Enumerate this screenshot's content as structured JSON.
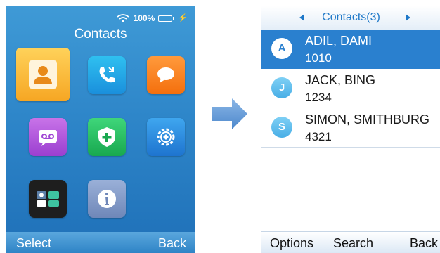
{
  "status_bar": {
    "battery_text": "100%",
    "icons": [
      "wifi-icon",
      "battery-icon",
      "charging-icon"
    ]
  },
  "menu": {
    "title": "Contacts",
    "apps": [
      {
        "name": "contacts-app",
        "icon": "contact-person-icon",
        "selected": true
      },
      {
        "name": "call-history-app",
        "icon": "call-log-icon"
      },
      {
        "name": "messages-app",
        "icon": "chat-bubble-icon"
      },
      {
        "name": "voicemail-app",
        "icon": "voicemail-icon"
      },
      {
        "name": "security-app",
        "icon": "shield-plus-icon"
      },
      {
        "name": "settings-app",
        "icon": "gear-icon"
      },
      {
        "name": "tools-app",
        "icon": "tools-icon"
      },
      {
        "name": "info-app",
        "icon": "info-icon"
      }
    ],
    "softkeys": {
      "left": "Select",
      "right": "Back"
    }
  },
  "transition": {
    "icon": "right-arrow-icon"
  },
  "contacts": {
    "title": "Contacts(3)",
    "items": [
      {
        "initial": "A",
        "name": "ADIL, DAMI",
        "number": "1010",
        "selected": true
      },
      {
        "initial": "J",
        "name": "JACK, BING",
        "number": "1234"
      },
      {
        "initial": "S",
        "name": "SIMON, SMITHBURG",
        "number": "4321"
      }
    ],
    "softkeys": {
      "left": "Options",
      "middle": "Search",
      "right": "Back"
    }
  },
  "colors": {
    "accent": "#2a80cf",
    "selected_tile": "#f6a623",
    "menu_background": "#2e86c9"
  }
}
